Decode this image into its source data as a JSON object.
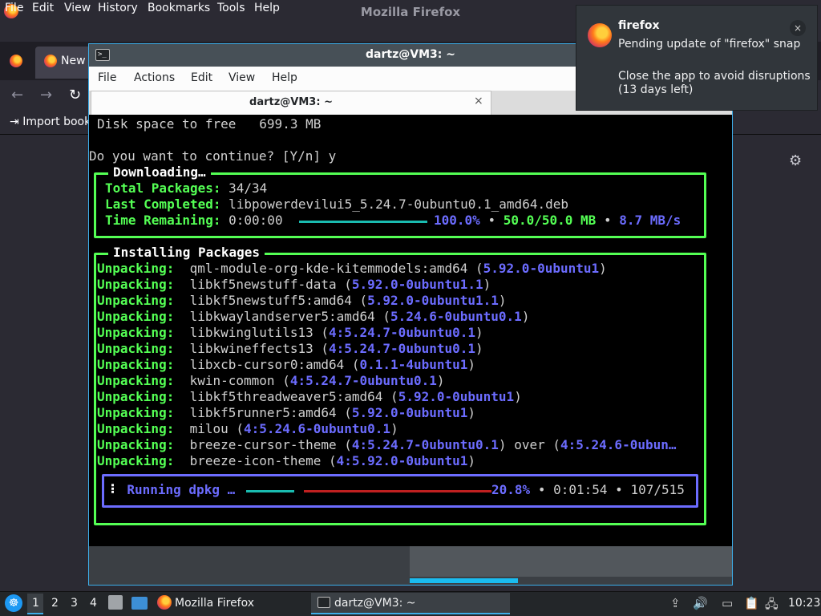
{
  "firefox": {
    "window_title": "Mozilla Firefox",
    "menu": [
      "File",
      "Edit",
      "View",
      "History",
      "Bookmarks",
      "Tools",
      "Help"
    ],
    "tab_label": "New",
    "bookmark_label": "Import book",
    "nav": {
      "back": "←",
      "forward": "→",
      "reload": "↻"
    },
    "gear": "⚙"
  },
  "konsole": {
    "title": "dartz@VM3: ~",
    "menu": [
      "File",
      "Actions",
      "Edit",
      "View",
      "Help"
    ],
    "tab_label": "dartz@VM3: ~",
    "tab_close": "×",
    "prompt_icon": ">_"
  },
  "terminal": {
    "disk_line": "Disk space to free   699.3 MB",
    "continue_line": "Do you want to continue? [Y/n] y",
    "downloading": {
      "title": "Downloading…",
      "total_label": "Total Packages:",
      "total_value": "34/34",
      "last_label": "Last Completed:",
      "last_value": "libpowerdevilui5_5.24.7-0ubuntu0.1_amd64.deb",
      "time_label": "Time Remaining:",
      "time_value": "0:00:00",
      "percent": "100.0%",
      "sep": "•",
      "size": "50.0/50.0 MB",
      "speed": "8.7 MB/s",
      "progress": 1.0
    },
    "installing": {
      "title": "Installing Packages",
      "rows": [
        {
          "action": "Unpacking:",
          "pkg": "qml-module-org-kde-kitemmodels:amd64",
          "ver": "5.92.0-0ubuntu1",
          "tail": ""
        },
        {
          "action": "Unpacking:",
          "pkg": "libkf5newstuff-data",
          "ver": "5.92.0-0ubuntu1.1",
          "tail": ""
        },
        {
          "action": "Unpacking:",
          "pkg": "libkf5newstuff5:amd64",
          "ver": "5.92.0-0ubuntu1.1",
          "tail": ""
        },
        {
          "action": "Unpacking:",
          "pkg": "libkwaylandserver5:amd64",
          "ver": "5.24.6-0ubuntu0.1",
          "tail": ""
        },
        {
          "action": "Unpacking:",
          "pkg": "libkwinglutils13",
          "ver": "4:5.24.7-0ubuntu0.1",
          "tail": ""
        },
        {
          "action": "Unpacking:",
          "pkg": "libkwineffects13",
          "ver": "4:5.24.7-0ubuntu0.1",
          "tail": ""
        },
        {
          "action": "Unpacking:",
          "pkg": "libxcb-cursor0:amd64",
          "ver": "0.1.1-4ubuntu1",
          "tail": ""
        },
        {
          "action": "Unpacking:",
          "pkg": "kwin-common",
          "ver": "4:5.24.7-0ubuntu0.1",
          "tail": ""
        },
        {
          "action": "Unpacking:",
          "pkg": "libkf5threadweaver5:amd64",
          "ver": "5.92.0-0ubuntu1",
          "tail": ""
        },
        {
          "action": "Unpacking:",
          "pkg": "libkf5runner5:amd64",
          "ver": "5.92.0-0ubuntu1",
          "tail": ""
        },
        {
          "action": "Unpacking:",
          "pkg": "milou",
          "ver": "4:5.24.6-0ubuntu0.1",
          "tail": ""
        },
        {
          "action": "Unpacking:",
          "pkg": "breeze-cursor-theme",
          "ver": "4:5.24.7-0ubuntu0.1",
          "tail": " over (",
          "tail_ver": "4:5.24.6-0ubun…"
        },
        {
          "action": "Unpacking:",
          "pkg": "breeze-icon-theme",
          "ver": "4:5.92.0-0ubuntu1",
          "tail": ""
        }
      ],
      "dpkg": {
        "spinner": "⠇",
        "label": "Running dpkg …",
        "percent": "20.8%",
        "elapsed": "0:01:54",
        "count": "107/515",
        "sep": "•",
        "progress": 0.208
      }
    }
  },
  "notification": {
    "app": "firefox",
    "line1": "Pending update of \"firefox\" snap",
    "line2": "Close the app to avoid disruptions (13 days left)",
    "close": "×"
  },
  "taskbar": {
    "start": "☸",
    "desktops": [
      "1",
      "2",
      "3",
      "4"
    ],
    "firefox_label": "Mozilla Firefox",
    "terminal_label": "dartz@VM3: ~",
    "tray": {
      "updates": "⇪",
      "volume": "🔊",
      "display": "▭",
      "clipboard": "📋",
      "network": "🖧"
    },
    "clock": "10:23"
  },
  "colors": {
    "accent": "#3daee9",
    "term_green": "#54ff54",
    "term_blue": "#6c6cff",
    "bar_cyan": "#1abcb0",
    "bar_red": "#c02020"
  }
}
